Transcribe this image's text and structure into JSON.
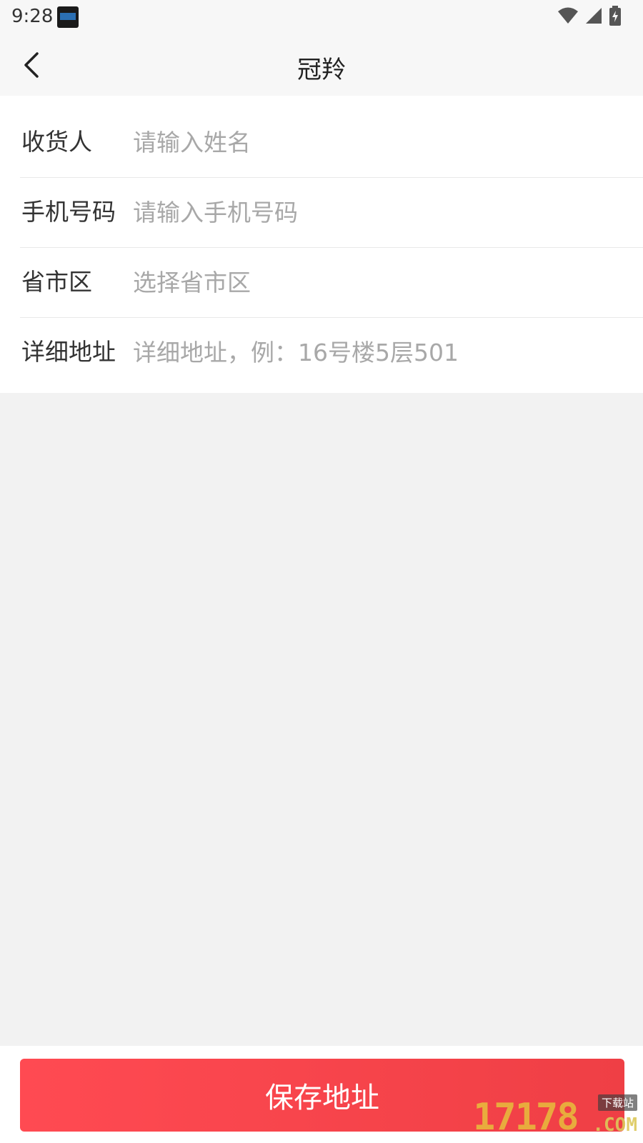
{
  "status_bar": {
    "time": "9:28",
    "icons": [
      "wifi-icon",
      "signal-icon",
      "battery-charging-icon"
    ]
  },
  "header": {
    "title": "冠羚",
    "back_icon": "chevron-left-icon"
  },
  "form": {
    "rows": [
      {
        "label": "收货人",
        "placeholder": "请输入姓名",
        "value": ""
      },
      {
        "label": "手机号码",
        "placeholder": "请输入手机号码",
        "value": ""
      },
      {
        "label": "省市区",
        "placeholder": "选择省市区",
        "value": ""
      },
      {
        "label": "详细地址",
        "placeholder": "详细地址，例：16号楼5层501",
        "value": ""
      }
    ]
  },
  "footer": {
    "save_label": "保存地址"
  },
  "watermark": {
    "number": "17178",
    "com": ".COM",
    "badge": "下载站"
  },
  "colors": {
    "accent": "#ff4a52",
    "background": "#f2f2f2",
    "placeholder": "#a8a8a8"
  }
}
